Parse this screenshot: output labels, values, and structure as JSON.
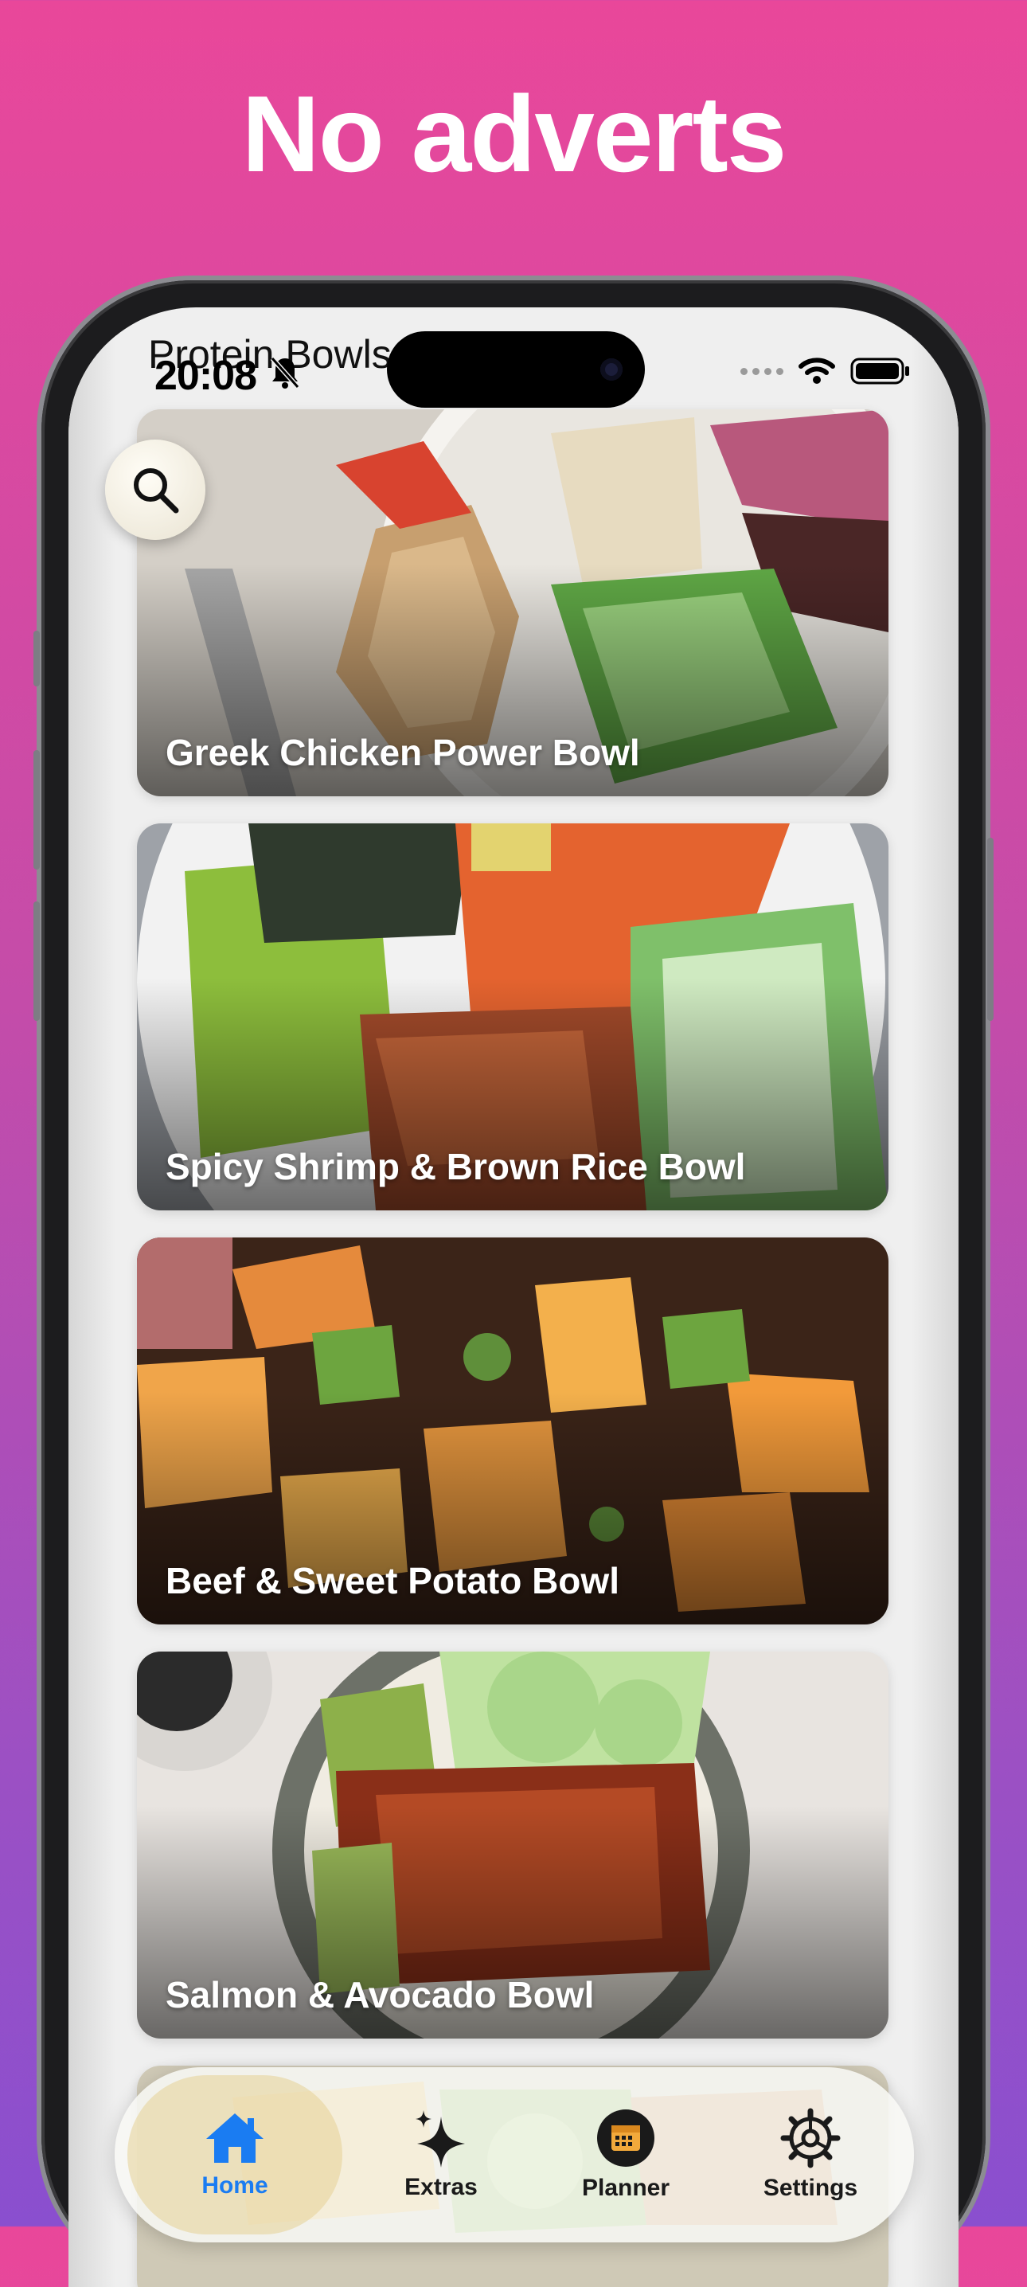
{
  "headline": "No adverts",
  "status_bar": {
    "time": "20:08"
  },
  "nav": {
    "title": "Protein Bowls"
  },
  "search": {
    "icon": "magnifier"
  },
  "recipes": [
    {
      "title": "Greek Chicken Power Bowl"
    },
    {
      "title": "Spicy Shrimp & Brown Rice Bowl"
    },
    {
      "title": "Beef & Sweet Potato Bowl"
    },
    {
      "title": "Salmon & Avocado Bowl"
    }
  ],
  "tab_bar": {
    "tabs": [
      {
        "label": "Home",
        "icon": "house-icon",
        "active": true
      },
      {
        "label": "Extras",
        "icon": "sparkles-icon",
        "active": false
      },
      {
        "label": "Planner",
        "icon": "calendar-icon",
        "active": false
      },
      {
        "label": "Settings",
        "icon": "gear-icon",
        "active": false
      }
    ]
  },
  "colors": {
    "background_top": "#e9479a",
    "background_bottom": "#8a4fcf",
    "accent": "#1a7cf2"
  }
}
